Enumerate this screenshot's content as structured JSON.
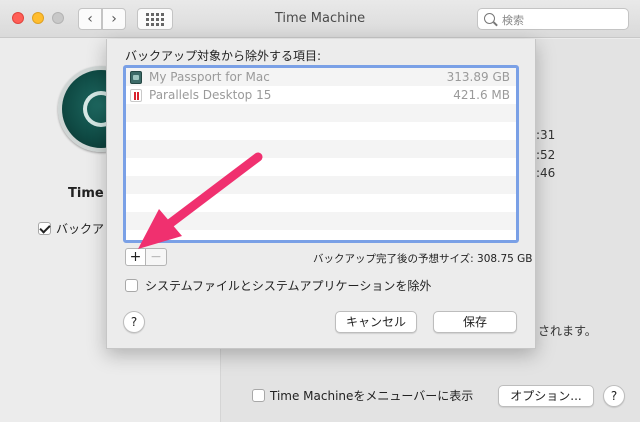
{
  "window": {
    "title": "Time Machine",
    "search_placeholder": "検索"
  },
  "background": {
    "app_name_partial": "Time M",
    "backup_auto_label_partial": "バックア",
    "times": [
      ":31",
      ":52",
      ":46"
    ],
    "note_partial": "されます。",
    "menubar_checkbox_label": "Time Machineをメニューバーに表示",
    "options_button": "オプション...",
    "help_label": "?"
  },
  "sheet": {
    "title": "バックアップ対象から除外する項目:",
    "items": [
      {
        "icon": "external-disk-icon",
        "name": "My Passport for Mac",
        "size": "313.89 GB"
      },
      {
        "icon": "parallels-icon",
        "name": "Parallels Desktop 15",
        "size": "421.6 MB"
      }
    ],
    "add_label": "+",
    "remove_label": "−",
    "estimate_label": "バックアップ完了後の予想サイズ: 308.75 GB",
    "exclude_system_label": "システムファイルとシステムアプリケーションを除外",
    "help_label": "?",
    "cancel_label": "キャンセル",
    "save_label": "保存"
  },
  "colors": {
    "annotation_arrow": "#f0306f",
    "list_focus_ring": "#7aa0e6"
  }
}
